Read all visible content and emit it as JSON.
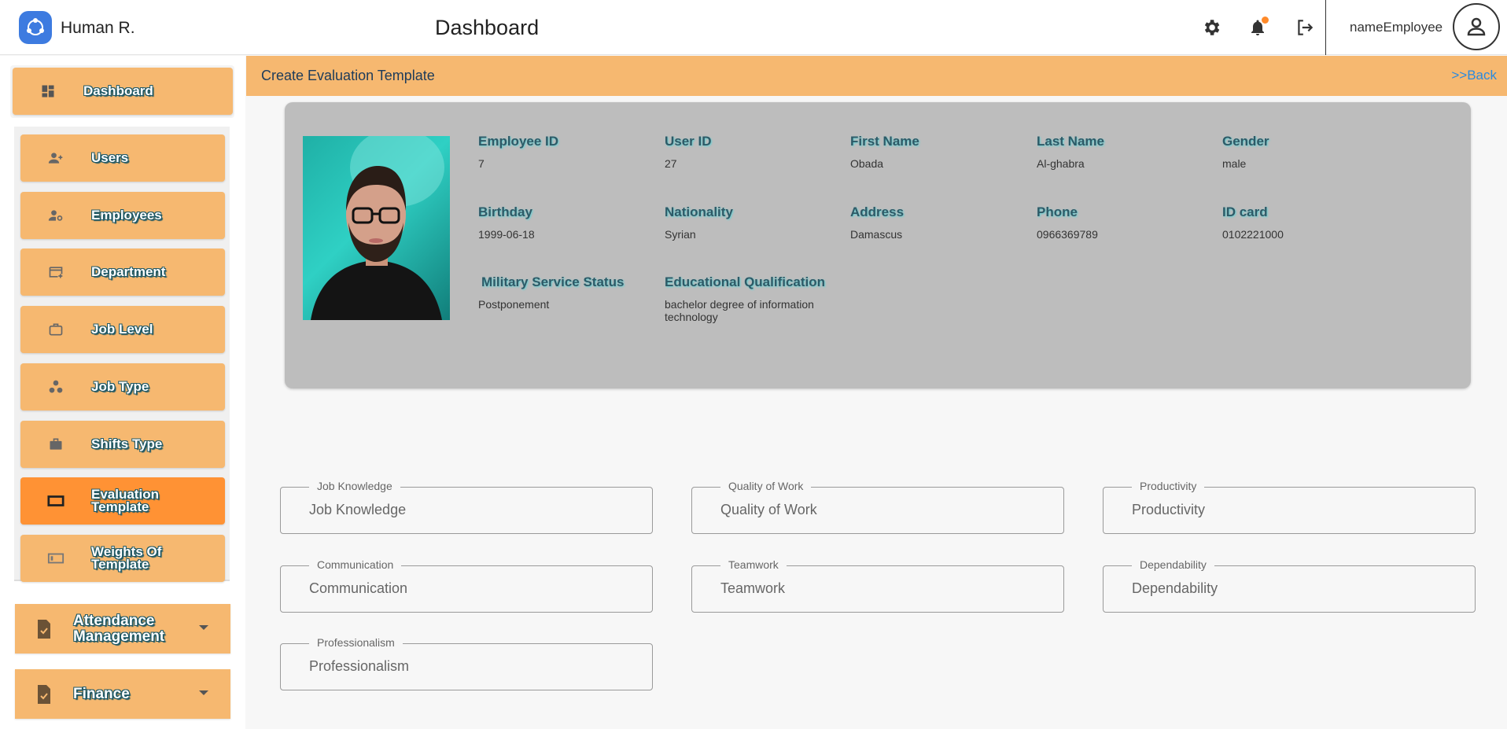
{
  "app": {
    "name": "Human R.",
    "page_title": "Dashboard",
    "username": "nameEmployee"
  },
  "colors": {
    "accent": "#f6b870",
    "active": "#ff9234",
    "card": "#bdbdbd",
    "link": "#2a8ae0"
  },
  "icons": {
    "logo": "share-nodes-icon",
    "settings": "gear-icon",
    "notifications": "bell-icon",
    "logout": "logout-icon",
    "avatar": "person-icon"
  },
  "sidebar": {
    "dashboard": "Dashboard",
    "items": [
      {
        "label": "Users",
        "icon": "person-add-icon"
      },
      {
        "label": "Employees",
        "icon": "person-gear-icon"
      },
      {
        "label": "Department",
        "icon": "card-add-icon"
      },
      {
        "label": "Job Level",
        "icon": "briefcase-outline-icon"
      },
      {
        "label": "Job Type",
        "icon": "bubble-chart-icon"
      },
      {
        "label": "Shifts Type",
        "icon": "briefcase-icon"
      },
      {
        "label": "Evaluation Template",
        "icon": "frame-icon",
        "active": true
      },
      {
        "label": "Weights Of Template",
        "icon": "frame-icon"
      }
    ],
    "groups": [
      {
        "label": "Attendance Management",
        "icon": "clipboard-check-icon"
      },
      {
        "label": "Finance",
        "icon": "clipboard-check-icon"
      }
    ]
  },
  "section": {
    "title": "Create Evaluation Template",
    "back": ">>Back"
  },
  "employee": {
    "employee_id": {
      "label": "Employee ID",
      "value": "7"
    },
    "user_id": {
      "label": "User ID",
      "value": "27"
    },
    "first_name": {
      "label": "First Name",
      "value": "Obada"
    },
    "last_name": {
      "label": "Last Name",
      "value": "Al-ghabra"
    },
    "gender": {
      "label": "Gender",
      "value": "male"
    },
    "birthday": {
      "label": "Birthday",
      "value": "1999-06-18"
    },
    "nationality": {
      "label": "Nationality",
      "value": "Syrian"
    },
    "address": {
      "label": "Address",
      "value": "Damascus"
    },
    "phone": {
      "label": "Phone",
      "value": "0966369789"
    },
    "id_card": {
      "label": "ID card",
      "value": "0102221000"
    },
    "military": {
      "label": "Military Service Status",
      "value": "Postponement"
    },
    "education": {
      "label": "Educational Qualification",
      "value": "bachelor degree of information technology"
    }
  },
  "form": {
    "job_knowledge": {
      "label": "Job Knowledge",
      "placeholder": "Job Knowledge"
    },
    "quality_of_work": {
      "label": "Quality of Work",
      "placeholder": "Quality of Work"
    },
    "productivity": {
      "label": "Productivity",
      "placeholder": "Productivity"
    },
    "communication": {
      "label": "Communication",
      "placeholder": "Communication"
    },
    "teamwork": {
      "label": "Teamwork",
      "placeholder": "Teamwork"
    },
    "dependability": {
      "label": "Dependability",
      "placeholder": "Dependability"
    },
    "professionalism": {
      "label": "Professionalism",
      "placeholder": "Professionalism"
    }
  }
}
